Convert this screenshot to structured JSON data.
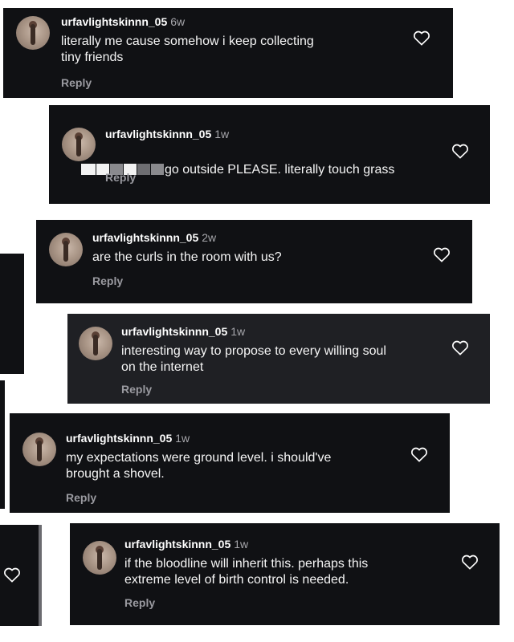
{
  "comments": [
    {
      "username": "urfavlightskinnn_05",
      "age": "6w",
      "text": "literally me cause somehow i keep collecting\ntiny friends",
      "reply_label": "Reply"
    },
    {
      "username": "urfavlightskinnn_05",
      "age": "1w",
      "text": "go outside PLEASE. literally touch grass",
      "reply_label": "Reply"
    },
    {
      "username": "urfavlightskinnn_05",
      "age": "2w",
      "text": "are the curls in the room with us?",
      "reply_label": "Reply"
    },
    {
      "username": "urfavlightskinnn_05",
      "age": "1w",
      "text": "interesting way to propose to every willing soul\non the internet",
      "reply_label": "Reply"
    },
    {
      "username": "urfavlightskinnn_05",
      "age": "1w",
      "text": "my expectations were ground level. i should've\nbrought a shovel.",
      "reply_label": "Reply"
    },
    {
      "username": "urfavlightskinnn_05",
      "age": "1w",
      "text": "if the bloodline will inherit this. perhaps this\nextreme level of birth control is needed.",
      "reply_label": "Reply"
    }
  ],
  "colors": {
    "card_bg": "#101114",
    "card_bg_alt": "#1f2024",
    "text": "#f5f5f5",
    "muted": "#9a9aa0"
  },
  "icons": {
    "like": "heart-outline-icon",
    "avatar": "profile-photo"
  }
}
